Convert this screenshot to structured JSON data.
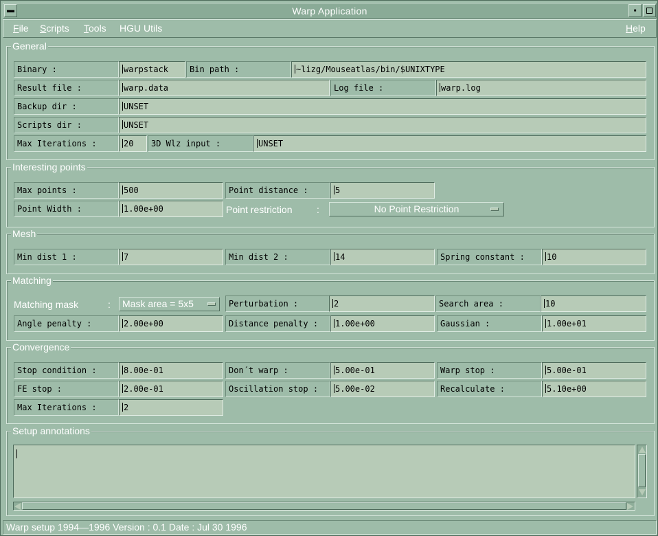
{
  "window": {
    "title": "Warp Application"
  },
  "menubar": {
    "items": [
      {
        "mnemonic": "F",
        "rest": "ile"
      },
      {
        "mnemonic": "S",
        "rest": "cripts"
      },
      {
        "mnemonic": "T",
        "rest": "ools"
      },
      {
        "mnemonic": "",
        "rest": "HGU Utils"
      }
    ],
    "help": {
      "mnemonic": "H",
      "rest": "elp"
    }
  },
  "general": {
    "title": "General",
    "binary_label": "Binary :",
    "binary_value": "warpstack",
    "bin_path_label": "Bin path :",
    "bin_path_value": "~lizg/Mouseatlas/bin/$UNIXTYPE",
    "result_file_label": "Result file :",
    "result_file_value": "warp.data",
    "log_file_label": "Log file :",
    "log_file_value": "warp.log",
    "backup_dir_label": "Backup dir :",
    "backup_dir_value": "UNSET",
    "scripts_dir_label": "Scripts dir :",
    "scripts_dir_value": "UNSET",
    "max_iter_label": "Max Iterations :",
    "max_iter_value": "20",
    "wlz_input_label": "3D Wlz input :",
    "wlz_input_value": "UNSET"
  },
  "interesting": {
    "title": "Interesting points",
    "max_points_label": "Max points :",
    "max_points_value": "500",
    "point_distance_label": "Point distance :",
    "point_distance_value": "5",
    "point_width_label": "Point Width :",
    "point_width_value": "1.00e+00",
    "point_restriction_label": "Point restriction",
    "point_restriction_colon": ":",
    "point_restriction_value": "No Point Restriction"
  },
  "mesh": {
    "title": "Mesh",
    "min_dist1_label": "Min dist 1 :",
    "min_dist1_value": "7",
    "min_dist2_label": "Min dist 2 :",
    "min_dist2_value": "14",
    "spring_label": "Spring constant :",
    "spring_value": "10"
  },
  "matching": {
    "title": "Matching",
    "mask_label": "Matching mask",
    "mask_colon": ":",
    "mask_value": "Mask area = 5x5",
    "perturbation_label": "Perturbation :",
    "perturbation_value": "2",
    "search_area_label": "Search area :",
    "search_area_value": "10",
    "angle_label": "Angle penalty :",
    "angle_value": "2.00e+00",
    "distance_label": "Distance penalty :",
    "distance_value": "1.00e+00",
    "gaussian_label": "Gaussian :",
    "gaussian_value": "1.00e+01"
  },
  "convergence": {
    "title": "Convergence",
    "stop_cond_label": "Stop condition :",
    "stop_cond_value": "8.00e-01",
    "dont_warp_label": "Don´t warp :",
    "dont_warp_value": "5.00e-01",
    "warp_stop_label": "Warp stop :",
    "warp_stop_value": "5.00e-01",
    "fe_stop_label": "FE stop :",
    "fe_stop_value": "2.00e-01",
    "oscillation_label": "Oscillation stop :",
    "oscillation_value": "5.00e-02",
    "recalc_label": "Recalculate :",
    "recalc_value": "5.10e+00",
    "max_iter_label": "Max Iterations :",
    "max_iter_value": "2"
  },
  "annotations": {
    "title": "Setup annotations",
    "value": ""
  },
  "status": {
    "text": "Warp setup 1994—1996 Version : 0.1 Date : Jul 30 1996"
  }
}
